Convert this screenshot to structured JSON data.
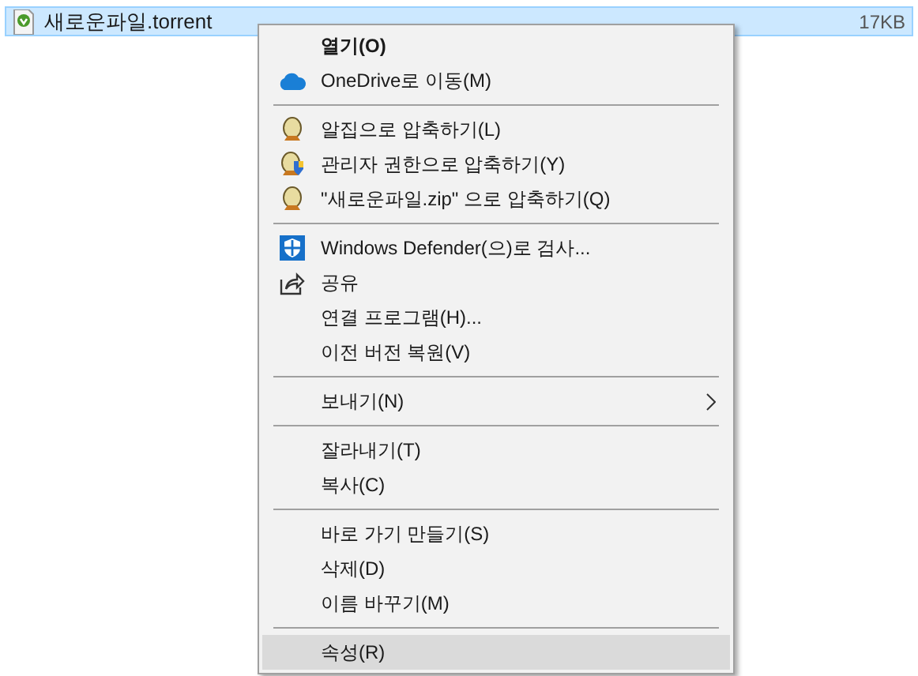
{
  "file_row": {
    "name": "새로운파일.torrent",
    "size": "17KB",
    "selected": true
  },
  "menu": {
    "sections": [
      [
        {
          "label": "열기(O)",
          "kind": "plain",
          "bold": true,
          "submenu": false,
          "selected": false
        },
        {
          "label": "OneDrive로 이동(M)",
          "kind": "cloud",
          "bold": false,
          "submenu": false,
          "selected": false
        }
      ],
      [
        {
          "label": "알집으로 압축하기(L)",
          "kind": "egg",
          "bold": false,
          "submenu": false,
          "selected": false
        },
        {
          "label": "관리자 권한으로 압축하기(Y)",
          "kind": "admin",
          "bold": false,
          "submenu": false,
          "selected": false
        },
        {
          "label": "\"새로운파일.zip\" 으로 압축하기(Q)",
          "kind": "egg",
          "bold": false,
          "submenu": false,
          "selected": false
        }
      ],
      [
        {
          "label": "Windows Defender(으)로 검사...",
          "kind": "defender",
          "bold": false,
          "submenu": false,
          "selected": false
        },
        {
          "label": "공유",
          "kind": "share",
          "bold": false,
          "submenu": false,
          "selected": false
        },
        {
          "label": "연결 프로그램(H)...",
          "kind": "plain",
          "bold": false,
          "submenu": false,
          "selected": false
        },
        {
          "label": "이전 버전 복원(V)",
          "kind": "plain",
          "bold": false,
          "submenu": false,
          "selected": false
        }
      ],
      [
        {
          "label": "보내기(N)",
          "kind": "plain",
          "bold": false,
          "submenu": true,
          "selected": false
        }
      ],
      [
        {
          "label": "잘라내기(T)",
          "kind": "plain",
          "bold": false,
          "submenu": false,
          "selected": false
        },
        {
          "label": "복사(C)",
          "kind": "plain",
          "bold": false,
          "submenu": false,
          "selected": false
        }
      ],
      [
        {
          "label": "바로 가기 만들기(S)",
          "kind": "plain",
          "bold": false,
          "submenu": false,
          "selected": false
        },
        {
          "label": "삭제(D)",
          "kind": "plain",
          "bold": false,
          "submenu": false,
          "selected": false
        },
        {
          "label": "이름 바꾸기(M)",
          "kind": "plain",
          "bold": false,
          "submenu": false,
          "selected": false
        }
      ],
      [
        {
          "label": "속성(R)",
          "kind": "plain",
          "bold": false,
          "submenu": false,
          "selected": true
        }
      ]
    ]
  }
}
